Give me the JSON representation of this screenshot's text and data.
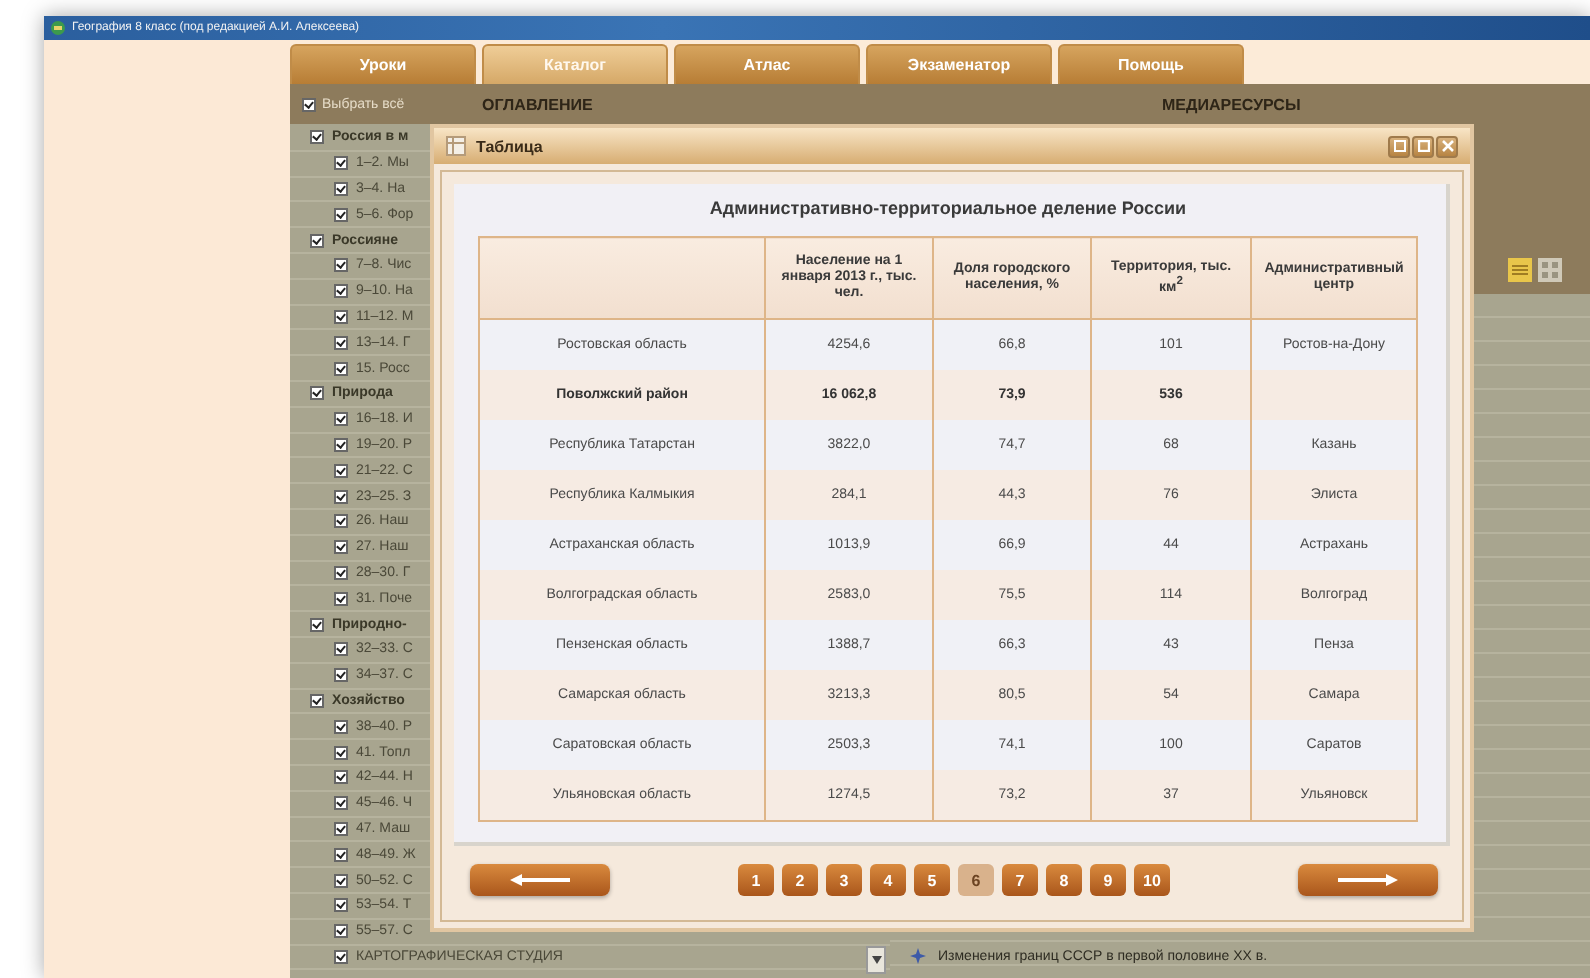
{
  "window": {
    "title": "География 8 класс (под редакцией А.И. Алексеева)"
  },
  "tabs": [
    {
      "label": "Уроки",
      "selected": false
    },
    {
      "label": "Каталог",
      "selected": true
    },
    {
      "label": "Атлас",
      "selected": false
    },
    {
      "label": "Экзаменатор",
      "selected": false
    },
    {
      "label": "Помощь",
      "selected": false
    }
  ],
  "select_all": {
    "label": "Выбрать всё",
    "checked": true
  },
  "contents_heading": "ОГЛАВЛЕНИЕ",
  "media_heading": "МЕДИАРЕСУРСЫ",
  "tree": [
    {
      "label": "Россия в м",
      "checked": true,
      "children": [
        {
          "label": "1–2. Мы",
          "checked": true
        },
        {
          "label": "3–4. На",
          "checked": true
        },
        {
          "label": "5–6. Фор",
          "checked": true
        }
      ]
    },
    {
      "label": "Россияне",
      "checked": true,
      "children": [
        {
          "label": "7–8. Чис",
          "checked": true
        },
        {
          "label": "9–10. На",
          "checked": true
        },
        {
          "label": "11–12. М",
          "checked": true
        },
        {
          "label": "13–14. Г",
          "checked": true
        },
        {
          "label": "15. Росс",
          "checked": true
        }
      ]
    },
    {
      "label": "Природа",
      "checked": true,
      "children": [
        {
          "label": "16–18. И",
          "checked": true
        },
        {
          "label": "19–20. Р",
          "checked": true
        },
        {
          "label": "21–22. С",
          "checked": true
        },
        {
          "label": "23–25. З",
          "checked": true
        },
        {
          "label": "26. Наш",
          "checked": true
        },
        {
          "label": "27. Наш",
          "checked": true
        },
        {
          "label": "28–30. Г",
          "checked": true
        },
        {
          "label": "31. Поче",
          "checked": true
        }
      ]
    },
    {
      "label": "Природно-",
      "checked": true,
      "children": [
        {
          "label": "32–33. С",
          "checked": true
        },
        {
          "label": "34–37. С",
          "checked": true
        }
      ]
    },
    {
      "label": "Хозяйство",
      "checked": true,
      "children": [
        {
          "label": "38–40. Р",
          "checked": true
        },
        {
          "label": "41. Топл",
          "checked": true
        },
        {
          "label": "42–44. Н",
          "checked": true
        },
        {
          "label": "45–46. Ч",
          "checked": true
        },
        {
          "label": "47. Маш",
          "checked": true
        },
        {
          "label": "48–49. Ж",
          "checked": true
        },
        {
          "label": "50–52. С",
          "checked": true
        },
        {
          "label": "53–54. Т",
          "checked": true
        },
        {
          "label": "55–57. С",
          "checked": true
        },
        {
          "label": "КАРТОГРАФИЧЕСКАЯ СТУДИЯ",
          "checked": true
        }
      ]
    }
  ],
  "media_items": [
    {
      "label": "Изменения границ СССР в первой половине XX в."
    }
  ],
  "dialog": {
    "title": "Таблица",
    "heading": "Административно-территориальное деление России",
    "columns": [
      "",
      "Население на 1 января 2013 г., тыс. чел.",
      "Доля городского населения, %",
      "Территория, тыс. км$^{2}$",
      "Административный центр"
    ],
    "rows": [
      {
        "kind": "region",
        "cells": [
          "Ростовская область",
          "4254,6",
          "66,8",
          "101",
          "Ростов-на-Дону"
        ]
      },
      {
        "kind": "summary",
        "cells": [
          "Поволжский район",
          "16 062,8",
          "73,9",
          "536",
          ""
        ]
      },
      {
        "kind": "region",
        "cells": [
          "Республика Татарстан",
          "3822,0",
          "74,7",
          "68",
          "Казань"
        ]
      },
      {
        "kind": "region",
        "cells": [
          "Республика Калмыкия",
          "284,1",
          "44,3",
          "76",
          "Элиста"
        ]
      },
      {
        "kind": "region",
        "cells": [
          "Астраханская область",
          "1013,9",
          "66,9",
          "44",
          "Астрахань"
        ]
      },
      {
        "kind": "region",
        "cells": [
          "Волгоградская область",
          "2583,0",
          "75,5",
          "114",
          "Волгоград"
        ]
      },
      {
        "kind": "region",
        "cells": [
          "Пензенская область",
          "1388,7",
          "66,3",
          "43",
          "Пенза"
        ]
      },
      {
        "kind": "region",
        "cells": [
          "Самарская область",
          "3213,3",
          "80,5",
          "54",
          "Самара"
        ]
      },
      {
        "kind": "region",
        "cells": [
          "Саратовская область",
          "2503,3",
          "74,1",
          "100",
          "Саратов"
        ]
      },
      {
        "kind": "region",
        "cells": [
          "Ульяновская область",
          "1274,5",
          "73,2",
          "37",
          "Ульяновск"
        ]
      }
    ],
    "pages": [
      {
        "label": "1",
        "selected": false
      },
      {
        "label": "2",
        "selected": false
      },
      {
        "label": "3",
        "selected": false
      },
      {
        "label": "4",
        "selected": false
      },
      {
        "label": "5",
        "selected": false
      },
      {
        "label": "6",
        "selected": true
      },
      {
        "label": "7",
        "selected": false
      },
      {
        "label": "8",
        "selected": false
      },
      {
        "label": "9",
        "selected": false
      },
      {
        "label": "10",
        "selected": false
      }
    ]
  }
}
